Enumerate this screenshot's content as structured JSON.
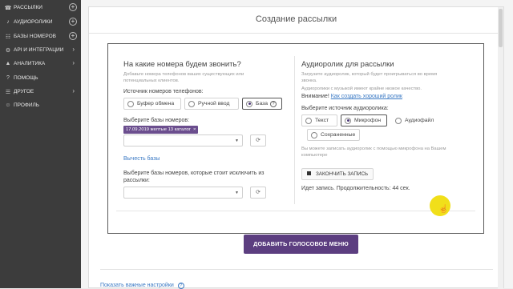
{
  "sidebar": {
    "items": [
      {
        "icon": "phone-icon",
        "icon_char": "☎",
        "label": "РАССЫЛКИ",
        "action": "plus"
      },
      {
        "icon": "audio-icon",
        "icon_char": "♪",
        "label": "АУДИОРОЛИКИ",
        "action": "plus"
      },
      {
        "icon": "database-icon",
        "icon_char": "☷",
        "label": "БАЗЫ НОМЕРОВ",
        "action": "plus"
      },
      {
        "icon": "api-icon",
        "icon_char": "⚙",
        "label": "API И ИНТЕГРАЦИИ",
        "action": "arrow"
      },
      {
        "icon": "analytics-icon",
        "icon_char": "▲",
        "label": "АНАЛИТИКА",
        "action": "arrow"
      },
      {
        "icon": "help-icon",
        "icon_char": "?",
        "label": "ПОМОЩЬ",
        "action": ""
      },
      {
        "icon": "menu-icon",
        "icon_char": "☰",
        "label": "ДРУГОЕ",
        "action": "arrow"
      },
      {
        "icon": "user-icon",
        "icon_char": "☺",
        "label": "ПРОФИЛЬ",
        "action": ""
      }
    ]
  },
  "page": {
    "title": "Создание рассылки"
  },
  "left": {
    "heading": "На какие номера будем звонить?",
    "hint_line1": "Добавьте номера телефонов ваших существующих или",
    "hint_line2": "потенциальных клиентов.",
    "source_label": "Источник номеров телефонов:",
    "source_options": [
      "Буфер обмена",
      "Ручной ввод",
      "База"
    ],
    "source_selected": "База",
    "bases_label": "Выберите базы номеров:",
    "selected_base_tag": "17.09.2019 желтые 13 каталог",
    "subtract_link": "Вычесть базы",
    "exclude_label_line1": "Выберите базы номеров, которые стоит исключить из",
    "exclude_label_line2": "рассылки:"
  },
  "right": {
    "heading": "Аудиоролик для рассылки",
    "hint_line1": "Загрузите аудиоролик, который будет проигрываться во время",
    "hint_line2": "звонка.",
    "hint_line3": "Аудиоролики с музыкой имеют крайне низкое качество.",
    "attention_prefix": "Внимание!",
    "attention_link": "Как создать хороший ролик",
    "source_label": "Выберите источник аудиоролика:",
    "source_options": [
      "Текст",
      "Микрофон",
      "Аудиофайл",
      "Сохраненные"
    ],
    "source_selected": "Микрофон",
    "mic_hint_line1": "Вы можете записать аудиоролик с помощью микрофона на Вашем",
    "mic_hint_line2": "компьютере",
    "stop_button": "ЗАКОНЧИТЬ ЗАПИСЬ",
    "recording_status": "Идет запись. Продолжительность: 44 сек."
  },
  "actions": {
    "add_voice_menu": "ДОБАВИТЬ ГОЛОСОВОЕ МЕНЮ"
  },
  "footer": {
    "show_settings": "Показать важные настройки"
  },
  "colors": {
    "sidebar_bg": "#3c3c3c",
    "accent": "#5c3e80",
    "link": "#3a79c4"
  }
}
